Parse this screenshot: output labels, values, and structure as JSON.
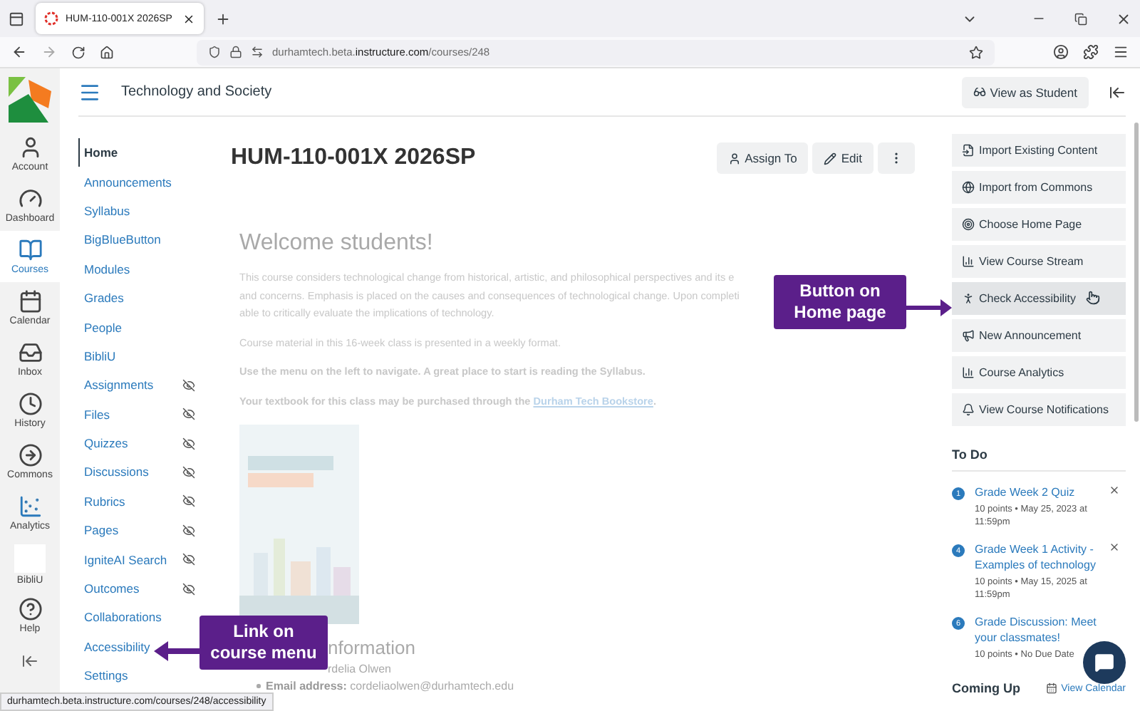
{
  "browser": {
    "tab_title": "HUM-110-001X 2026SP",
    "url": "durhamtech.beta.**instructure.com**/courses/248"
  },
  "global_nav": [
    {
      "label": "Account",
      "kind": "account",
      "selected": false
    },
    {
      "label": "Dashboard",
      "kind": "dashboard",
      "selected": false
    },
    {
      "label": "Courses",
      "kind": "courses",
      "selected": true
    },
    {
      "label": "Calendar",
      "kind": "calendar",
      "selected": false
    },
    {
      "label": "Inbox",
      "kind": "inbox",
      "selected": false
    },
    {
      "label": "History",
      "kind": "history",
      "selected": false
    },
    {
      "label": "Commons",
      "kind": "commons",
      "selected": false
    },
    {
      "label": "Analytics",
      "kind": "analytics",
      "selected": false
    },
    {
      "label": "BibliU",
      "kind": "bibliu",
      "selected": false
    },
    {
      "label": "Help",
      "kind": "help",
      "selected": false
    }
  ],
  "header": {
    "course_title": "Technology and Society",
    "view_as_student": "View as Student"
  },
  "course_nav": [
    {
      "label": "Home",
      "selected": true,
      "hidden": false
    },
    {
      "label": "Announcements",
      "selected": false,
      "hidden": false
    },
    {
      "label": "Syllabus",
      "selected": false,
      "hidden": false
    },
    {
      "label": "BigBlueButton",
      "selected": false,
      "hidden": false
    },
    {
      "label": "Modules",
      "selected": false,
      "hidden": false
    },
    {
      "label": "Grades",
      "selected": false,
      "hidden": false
    },
    {
      "label": "People",
      "selected": false,
      "hidden": false
    },
    {
      "label": "BibliU",
      "selected": false,
      "hidden": false
    },
    {
      "label": "Assignments",
      "selected": false,
      "hidden": true
    },
    {
      "label": "Files",
      "selected": false,
      "hidden": true
    },
    {
      "label": "Quizzes",
      "selected": false,
      "hidden": true
    },
    {
      "label": "Discussions",
      "selected": false,
      "hidden": true
    },
    {
      "label": "Rubrics",
      "selected": false,
      "hidden": true
    },
    {
      "label": "Pages",
      "selected": false,
      "hidden": true
    },
    {
      "label": "IgniteAI Search",
      "selected": false,
      "hidden": true
    },
    {
      "label": "Outcomes",
      "selected": false,
      "hidden": true
    },
    {
      "label": "Collaborations",
      "selected": false,
      "hidden": false
    },
    {
      "label": "Accessibility",
      "selected": false,
      "hidden": false
    },
    {
      "label": "Settings",
      "selected": false,
      "hidden": false
    }
  ],
  "page": {
    "title": "HUM-110-001X 2026SP",
    "actions": [
      {
        "label": "Assign To",
        "kind": "assign"
      },
      {
        "label": "Edit",
        "kind": "edit"
      },
      {
        "kind": "more"
      }
    ],
    "welcome": "Welcome students!",
    "paragraphs": [
      {
        "lines": [
          "This course considers technological change from historical, artistic, and philosophical perspectives and its e",
          "and concerns. Emphasis is placed on the causes and consequences of technological change. Upon completi",
          "able to critically evaluate the implications of technology."
        ],
        "bold": false
      },
      {
        "lines": [
          "Course material in this 16-week class is presented in a weekly format."
        ],
        "bold": false
      },
      {
        "lines": [
          "Use the menu on the left to navigate. A great place to start is reading the Syllabus."
        ],
        "bold": true
      },
      {
        "lines": [
          "Your textbook for this class may be purchased through the"
        ],
        "bold": true,
        "link": "Durham Tech Bookstore",
        "after": "."
      }
    ],
    "info_heading": "nformation",
    "info_lines": [
      {
        "value": "rdelia Olwen"
      },
      {
        "label": "Email address:",
        "value": "cordeliaolwen@durhamtech.edu",
        "bulleted": true
      }
    ]
  },
  "sidebar": {
    "buttons": [
      {
        "label": "Import Existing Content",
        "kind": "import",
        "hovered": false
      },
      {
        "label": "Import from Commons",
        "kind": "commons",
        "hovered": false
      },
      {
        "label": "Choose Home Page",
        "kind": "home",
        "hovered": false
      },
      {
        "label": "View Course Stream",
        "kind": "stream",
        "hovered": false
      },
      {
        "label": "Check Accessibility",
        "kind": "accessibility",
        "hovered": true
      },
      {
        "label": "New Announcement",
        "kind": "announcement",
        "hovered": false
      },
      {
        "label": "Course Analytics",
        "kind": "analytics",
        "hovered": false
      },
      {
        "label": "View Course Notifications",
        "kind": "notifications",
        "hovered": false
      }
    ],
    "todo_title": "To Do",
    "todo": [
      {
        "badge": "1",
        "title": "Grade Week 2 Quiz",
        "meta": "10 points • May 25, 2023 at 11:59pm",
        "dismissable": true
      },
      {
        "badge": "4",
        "title": "Grade Week 1 Activity - Examples of technology",
        "meta": "10 points • May 15, 2025 at 11:59pm",
        "dismissable": true
      },
      {
        "badge": "6",
        "title": "Grade Discussion: Meet your classmates!",
        "meta": "10 points • No Due Date",
        "dismissable": false
      }
    ],
    "coming_up": "Coming Up",
    "view_calendar": "View Calendar"
  },
  "annotations": [
    {
      "text": "Button on Home page",
      "kind": "right"
    },
    {
      "text": "Link on course menu",
      "kind": "left"
    }
  ],
  "status_url": "durhamtech.beta.instructure.com/courses/248/accessibility"
}
